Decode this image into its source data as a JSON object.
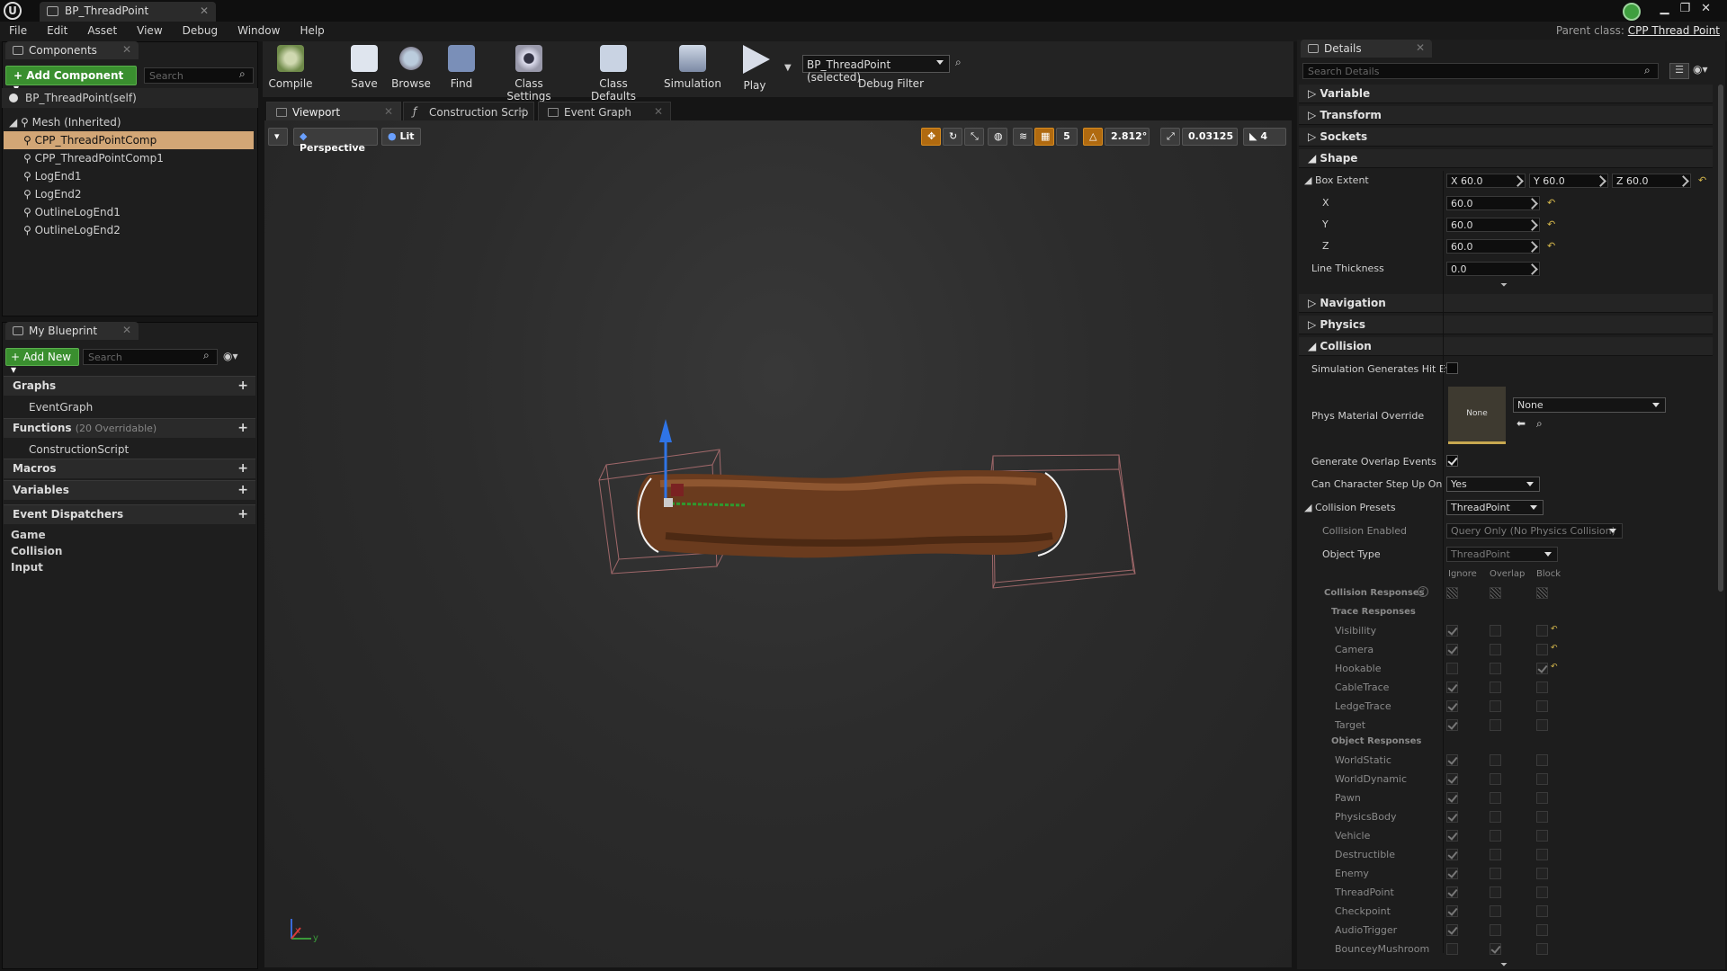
{
  "window": {
    "tab_title": "BP_ThreadPoint",
    "logo": "U"
  },
  "menu": [
    "File",
    "Edit",
    "Asset",
    "View",
    "Debug",
    "Window",
    "Help"
  ],
  "parent_class": {
    "label": "Parent class:",
    "value": "CPP Thread Point"
  },
  "components": {
    "tab": "Components",
    "add_button": "+ Add Component ▾",
    "search_placeholder": "Search",
    "self_item": "BP_ThreadPoint(self)",
    "tree": [
      {
        "label": "Mesh (Inherited)",
        "depth": 0,
        "selected": false
      },
      {
        "label": "CPP_ThreadPointComp",
        "depth": 1,
        "selected": true
      },
      {
        "label": "CPP_ThreadPointComp1",
        "depth": 1,
        "selected": false
      },
      {
        "label": "LogEnd1",
        "depth": 1,
        "selected": false
      },
      {
        "label": "LogEnd2",
        "depth": 1,
        "selected": false
      },
      {
        "label": "OutlineLogEnd1",
        "depth": 1,
        "selected": false
      },
      {
        "label": "OutlineLogEnd2",
        "depth": 1,
        "selected": false
      }
    ]
  },
  "my_blueprint": {
    "tab": "My Blueprint",
    "add_button": "+ Add New ▾",
    "search_placeholder": "Search",
    "graphs": "Graphs",
    "event_graph": "EventGraph",
    "functions": "Functions",
    "functions_note": "(20 Overridable)",
    "construction_script": "ConstructionScript",
    "macros": "Macros",
    "variables": "Variables",
    "event_dispatchers": "Event Dispatchers",
    "categories": [
      "Game",
      "Collision",
      "Input"
    ]
  },
  "toolbar": {
    "compile": "Compile",
    "save": "Save",
    "browse": "Browse",
    "find": "Find",
    "class_settings": "Class Settings",
    "class_defaults": "Class Defaults",
    "simulation": "Simulation",
    "play": "Play",
    "debug_select": "BP_ThreadPoint (selected)",
    "debug_filter": "Debug Filter"
  },
  "editor_tabs": [
    "Viewport",
    "Construction Scrip",
    "Event Graph"
  ],
  "viewport": {
    "perspective": "Perspective",
    "lit": "Lit",
    "grid_snap": "5",
    "angle_snap": "2.812°",
    "scale_snap": "0.03125",
    "camera_speed": "4",
    "axis_x": "x",
    "axis_y": "y"
  },
  "details": {
    "tab": "Details",
    "search_placeholder": "Search Details",
    "categories": {
      "variable": "Variable",
      "transform": "Transform",
      "sockets": "Sockets",
      "shape": "Shape",
      "navigation": "Navigation",
      "physics": "Physics",
      "collision": "Collision"
    },
    "shape": {
      "box_extent": "Box Extent",
      "bx": "X 60.0",
      "by": "Y 60.0",
      "bz": "Z 60.0",
      "x_label": "X",
      "x": "60.0",
      "y_label": "Y",
      "y": "60.0",
      "z_label": "Z",
      "z": "60.0",
      "line_thickness": "Line Thickness",
      "line_value": "0.0"
    },
    "collision": {
      "sim_hit": "Simulation Generates Hit Eve",
      "phys_material": "Phys Material Override",
      "phys_thumb": "None",
      "phys_select": "None",
      "overlap": "Generate Overlap Events",
      "step_up": "Can Character Step Up On",
      "step_up_value": "Yes",
      "presets": "Collision Presets",
      "presets_value": "ThreadPoint",
      "enabled": "Collision Enabled",
      "enabled_value": "Query Only (No Physics Collision)",
      "object_type": "Object Type",
      "object_type_value": "ThreadPoint",
      "col_ignore": "Ignore",
      "col_overlap": "Overlap",
      "col_block": "Block",
      "responses": "Collision Responses",
      "trace_header": "Trace Responses",
      "object_header": "Object Responses",
      "trace": [
        {
          "name": "Visibility",
          "state": "ignore"
        },
        {
          "name": "Camera",
          "state": "ignore"
        },
        {
          "name": "Hookable",
          "state": "block"
        },
        {
          "name": "CableTrace",
          "state": "ignore"
        },
        {
          "name": "LedgeTrace",
          "state": "ignore"
        },
        {
          "name": "Target",
          "state": "ignore"
        }
      ],
      "object": [
        {
          "name": "WorldStatic",
          "state": "ignore"
        },
        {
          "name": "WorldDynamic",
          "state": "ignore"
        },
        {
          "name": "Pawn",
          "state": "ignore"
        },
        {
          "name": "PhysicsBody",
          "state": "ignore"
        },
        {
          "name": "Vehicle",
          "state": "ignore"
        },
        {
          "name": "Destructible",
          "state": "ignore"
        },
        {
          "name": "Enemy",
          "state": "ignore"
        },
        {
          "name": "ThreadPoint",
          "state": "ignore"
        },
        {
          "name": "Checkpoint",
          "state": "ignore"
        },
        {
          "name": "AudioTrigger",
          "state": "ignore"
        },
        {
          "name": "BounceyMushroom",
          "state": "overlap"
        }
      ]
    }
  }
}
